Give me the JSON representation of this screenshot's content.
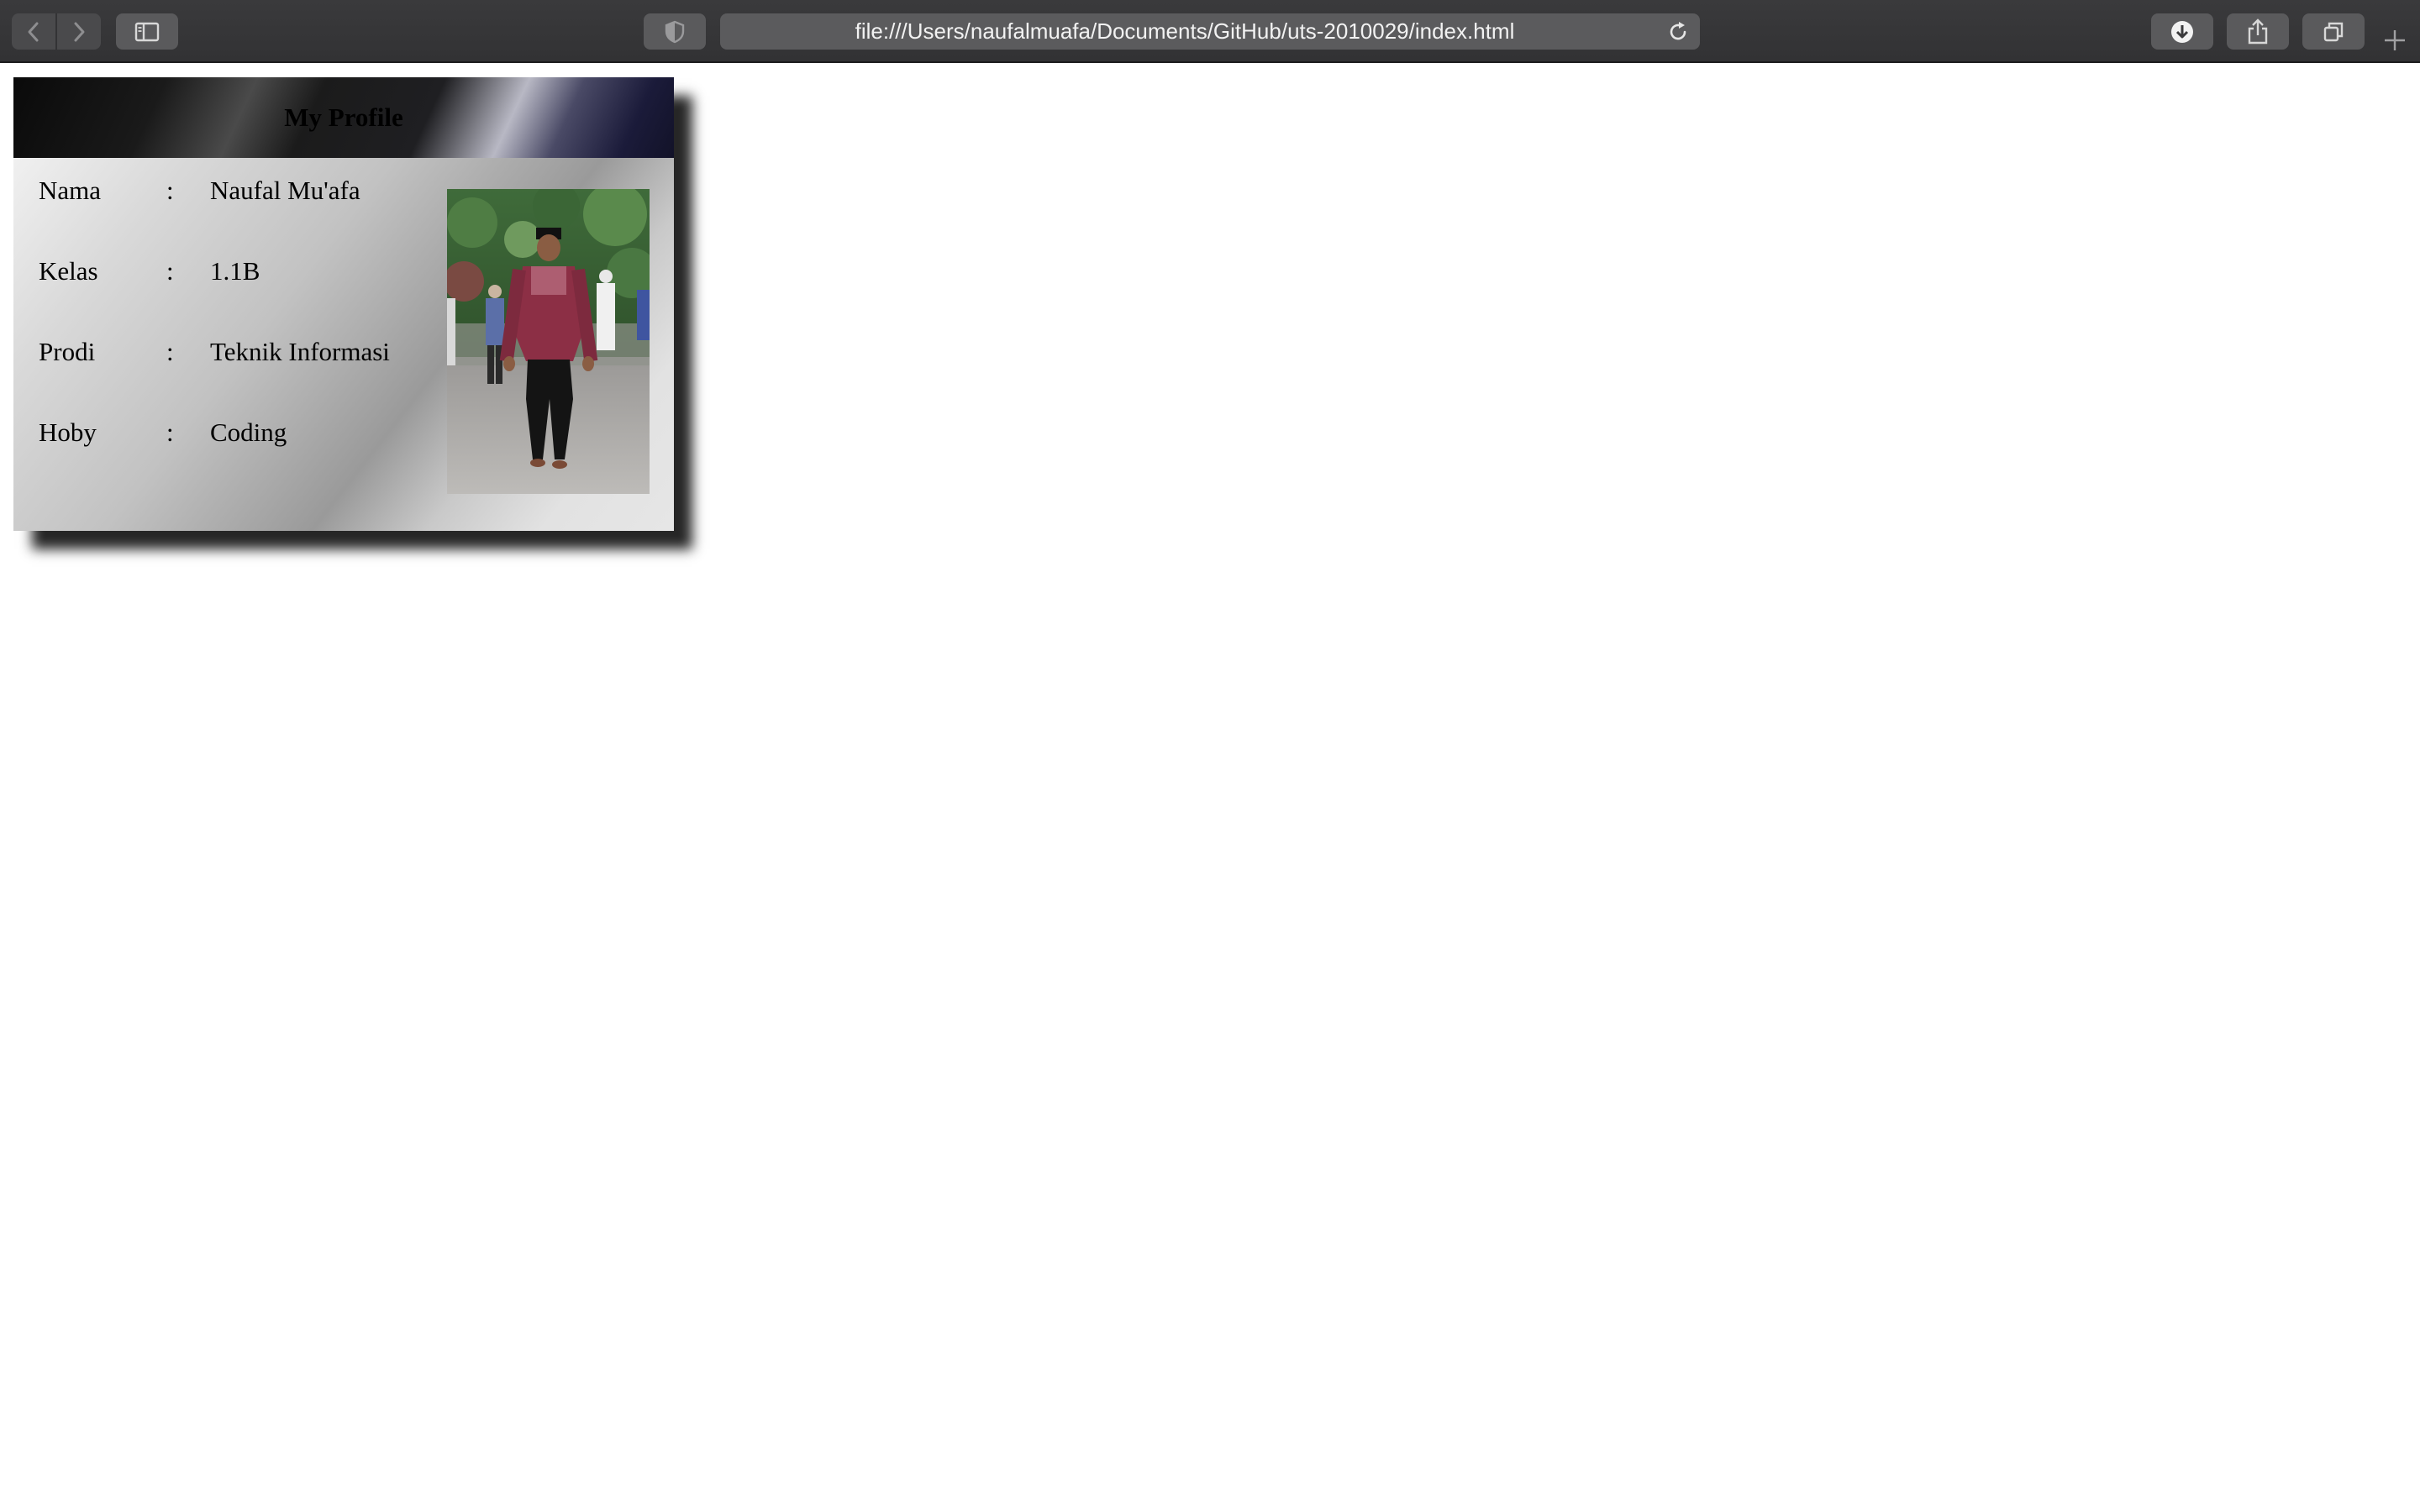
{
  "browser": {
    "url": "file:///Users/naufalmuafa/Documents/GitHub/uts-2010029/index.html"
  },
  "profile": {
    "title": "My Profile",
    "rows": [
      {
        "label": "Nama",
        "separator": ":",
        "value": "Naufal Mu'afa"
      },
      {
        "label": "Kelas",
        "separator": ":",
        "value": "1.1B"
      },
      {
        "label": "Prodi",
        "separator": ":",
        "value": "Teknik Informasi"
      },
      {
        "label": "Hoby",
        "separator": ":",
        "value": "Coding"
      }
    ],
    "photo_icon": "profile-photo"
  },
  "colors": {
    "toolbar": "#353537",
    "page_background": "#ffffff",
    "header_dark": "#0a0a0a",
    "shirt": "#8c2f45"
  }
}
